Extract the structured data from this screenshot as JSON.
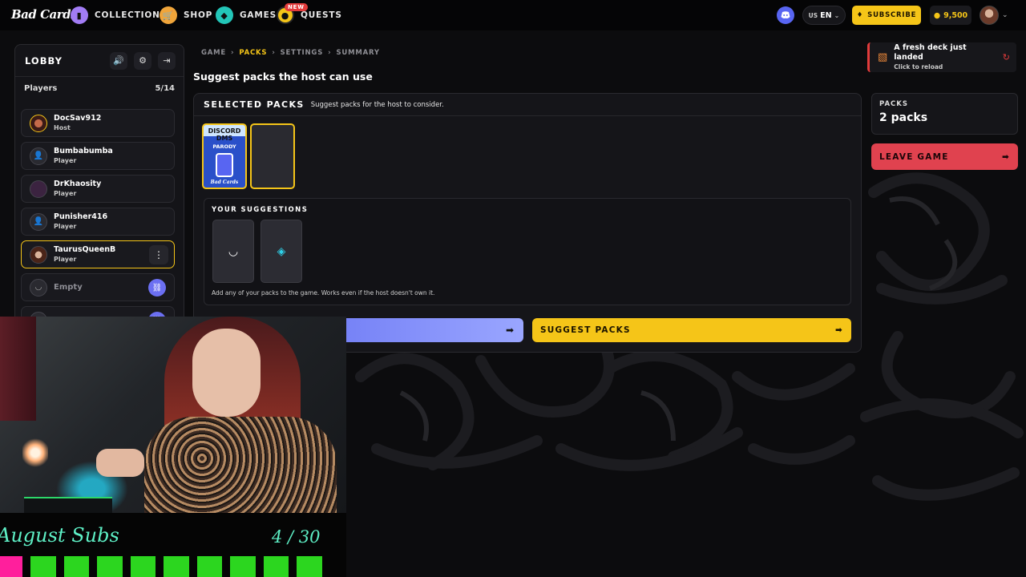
{
  "brand": {
    "logo_text": "Bad Cards"
  },
  "nav": {
    "items": [
      {
        "label": "COLLECTION",
        "icon": "card-icon",
        "color": "#a27cf5"
      },
      {
        "label": "SHOP",
        "icon": "cart-icon",
        "color": "#f0a53a"
      },
      {
        "label": "GAMES",
        "icon": "dice-icon",
        "color": "#23c6b8"
      },
      {
        "label": "QUESTS",
        "icon": "quest-icon",
        "color": "#f5c518",
        "badge": "NEW"
      }
    ],
    "lang_country": "US",
    "lang": "EN",
    "subscribe_label": "SUBSCRIBE",
    "coins": "9,500"
  },
  "lobby": {
    "title": "LOBBY",
    "players_label": "Players",
    "players_count": "5/14",
    "players": [
      {
        "name": "DocSav912",
        "role": "Host"
      },
      {
        "name": "Bumbabumba",
        "role": "Player"
      },
      {
        "name": "DrKhaosity",
        "role": "Player"
      },
      {
        "name": "Punisher416",
        "role": "Player"
      },
      {
        "name": "TaurusQueenB",
        "role": "Player"
      }
    ],
    "empty_label": "Empty"
  },
  "breadcrumb": [
    "GAME",
    "PACKS",
    "SETTINGS",
    "SUMMARY"
  ],
  "breadcrumb_active": "PACKS",
  "page_title": "Suggest packs the host can use",
  "selected_packs": {
    "title": "SELECTED PACKS",
    "subtitle": "Suggest packs for the host to consider.",
    "pack_1": {
      "line1": "DISCORD",
      "line2": "DMS",
      "line3": "PARODY",
      "brand": "Bad Cards"
    }
  },
  "suggestions": {
    "title": "YOUR SUGGESTIONS",
    "note": "Add any of your packs to the game. Works even if the host doesn't own it."
  },
  "buttons": {
    "suggest_packs": "SUGGEST PACKS",
    "leave_game": "LEAVE GAME"
  },
  "toast": {
    "title": "A fresh deck just landed",
    "subtitle": "Click to reload"
  },
  "packs_summary": {
    "label": "PACKS",
    "value": "2 packs"
  },
  "overlay": {
    "subs_title": "August Subs",
    "subs_count": "4 / 30",
    "colors": {
      "accent": "#5ef0c6",
      "bar_filled": "#2cd61f",
      "bar_pink": "#ff1f9c"
    }
  },
  "colors": {
    "accent_yellow": "#f5c518",
    "leave_red": "#e0424f",
    "discord": "#5865f2"
  }
}
